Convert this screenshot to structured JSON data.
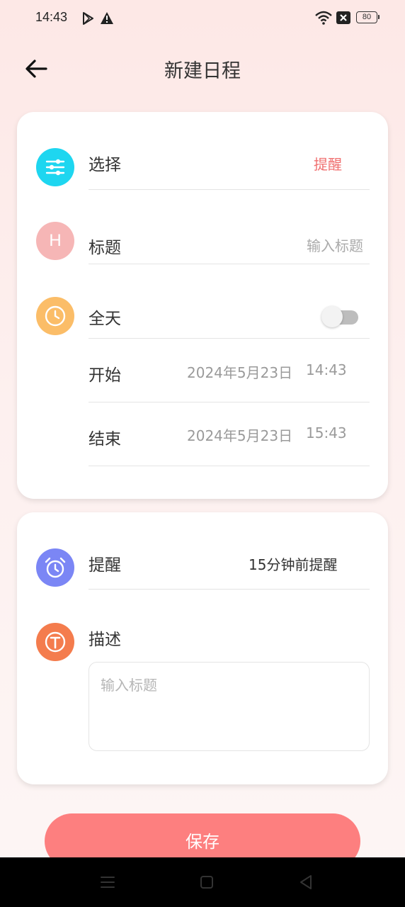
{
  "status_bar": {
    "time": "14:43",
    "battery": "80",
    "icons": [
      "play-store-notification-icon",
      "warning-icon",
      "wifi-icon",
      "sim-off-icon",
      "battery-icon"
    ]
  },
  "header": {
    "title": "新建日程",
    "back_icon": "arrow-left-icon"
  },
  "card1": {
    "select": {
      "label": "选择",
      "value": "提醒",
      "icon": "sliders-icon",
      "icon_color": "#1ed6f0",
      "value_color": "#f07070"
    },
    "title": {
      "label": "标题",
      "placeholder": "输入标题",
      "icon_letter": "H",
      "icon_color": "#f6b6b6"
    },
    "all_day": {
      "label": "全天",
      "enabled": false,
      "icon": "clock-icon",
      "icon_color": "#fbbd68"
    },
    "start": {
      "label": "开始",
      "date": "2024年5月23日",
      "time": "14:43"
    },
    "end": {
      "label": "结束",
      "date": "2024年5月23日",
      "time": "15:43"
    }
  },
  "card2": {
    "reminder": {
      "label": "提醒",
      "value": "15分钟前提醒",
      "icon": "alarm-clock-icon",
      "icon_color": "#7b86f5"
    },
    "description": {
      "label": "描述",
      "placeholder": "输入标题",
      "icon": "text-t-icon",
      "icon_color": "#f47c4d"
    }
  },
  "save_button": {
    "label": "保存",
    "color": "#fd7f7f"
  },
  "nav_bar": {
    "icons": [
      "menu-icon",
      "home-square-icon",
      "back-triangle-icon"
    ]
  }
}
